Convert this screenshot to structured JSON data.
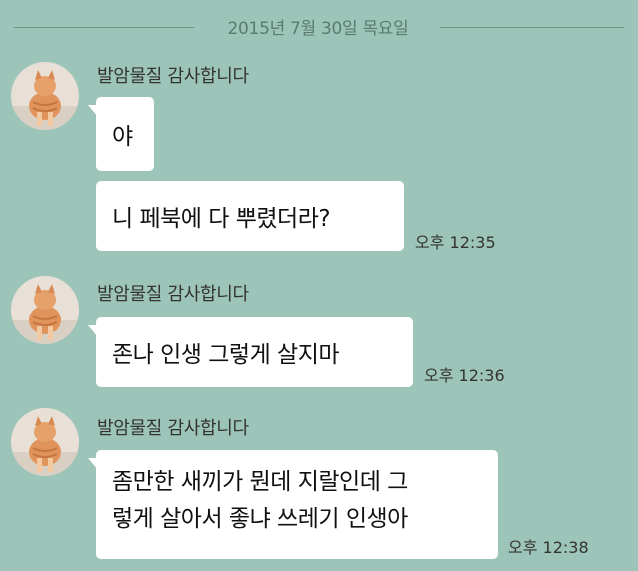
{
  "date_divider": "2015년 7월 30일 목요일",
  "messages": [
    {
      "sender": "발암물질 감사합니다",
      "bubbles": [
        "야",
        "니 페북에 다 뿌렸더라?"
      ],
      "time": "오후 12:35"
    },
    {
      "sender": "발암물질 감사합니다",
      "bubbles": [
        "존나 인생 그렇게 살지마"
      ],
      "time": "오후 12:36"
    },
    {
      "sender": "발암물질 감사합니다",
      "bubbles": [
        [
          "좀만한 새끼가 뭔데 지랄인데 그",
          "렇게 살아서 좋냐 쓰레기 인생아"
        ]
      ],
      "time": "오후 12:38"
    }
  ],
  "colors": {
    "background": "#9dc4b8",
    "bubble": "#ffffff"
  },
  "icons": {
    "avatar": "cat-avatar-icon"
  }
}
